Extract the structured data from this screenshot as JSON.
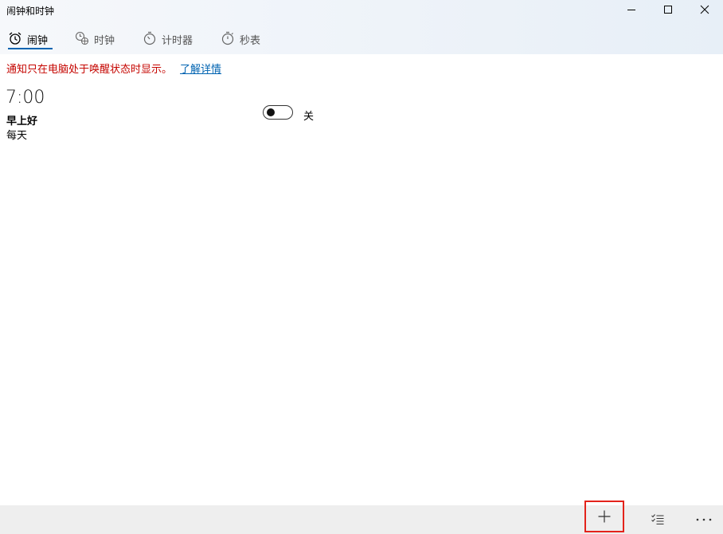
{
  "window": {
    "title": "闹钟和时钟",
    "minimize_icon": "minimize-icon",
    "maximize_icon": "maximize-icon",
    "close_icon": "close-icon"
  },
  "tabs": [
    {
      "label": "闹钟",
      "icon": "alarm-clock-icon",
      "active": true
    },
    {
      "label": "时钟",
      "icon": "world-clock-icon",
      "active": false
    },
    {
      "label": "计时器",
      "icon": "timer-icon",
      "active": false
    },
    {
      "label": "秒表",
      "icon": "stopwatch-icon",
      "active": false
    }
  ],
  "notice": {
    "text": "通知只在电脑处于唤醒状态时显示。",
    "link": "了解详情"
  },
  "alarms": [
    {
      "time": "7:00",
      "name": "早上好",
      "repeat": "每天",
      "enabled": false,
      "toggle_label": "关"
    }
  ],
  "bottombar": {
    "add_icon": "plus-icon",
    "select_icon": "select-list-icon",
    "more_icon": "more-icon"
  },
  "colors": {
    "accent": "#0063b1",
    "notice": "#c50500",
    "highlight": "#e3231b"
  }
}
